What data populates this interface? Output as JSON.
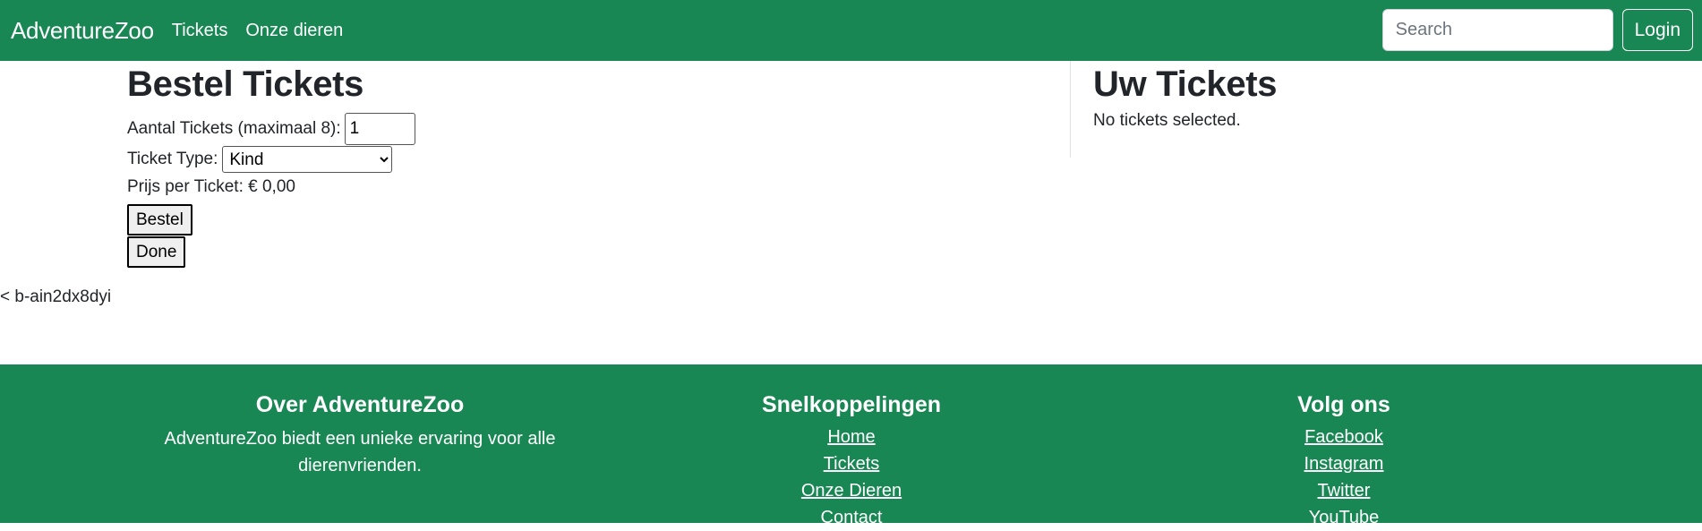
{
  "navbar": {
    "brand": "AdventureZoo",
    "links": [
      "Tickets",
      "Onze dieren"
    ],
    "search_placeholder": "Search",
    "login_label": "Login"
  },
  "order": {
    "title": "Bestel Tickets",
    "quantity_label": "Aantal Tickets (maximaal 8):",
    "quantity_value": "1",
    "type_label": "Ticket Type:",
    "type_selected": "Kind",
    "price_label": "Prijs per Ticket: € 0,00",
    "bestel_label": "Bestel",
    "done_label": "Done"
  },
  "error_text": "< b-ain2dx8dyi",
  "tickets": {
    "title": "Uw Tickets",
    "empty_message": "No tickets selected."
  },
  "footer": {
    "about": {
      "title": "Over AdventureZoo",
      "text": "AdventureZoo biedt een unieke ervaring voor alle dierenvrienden."
    },
    "links": {
      "title": "Snelkoppelingen",
      "items": [
        "Home",
        "Tickets",
        "Onze Dieren",
        "Contact"
      ]
    },
    "follow": {
      "title": "Volg ons",
      "items": [
        "Facebook",
        "Instagram",
        "Twitter",
        "YouTube"
      ]
    }
  },
  "colors": {
    "primary": "#198754",
    "text": "#212529"
  }
}
